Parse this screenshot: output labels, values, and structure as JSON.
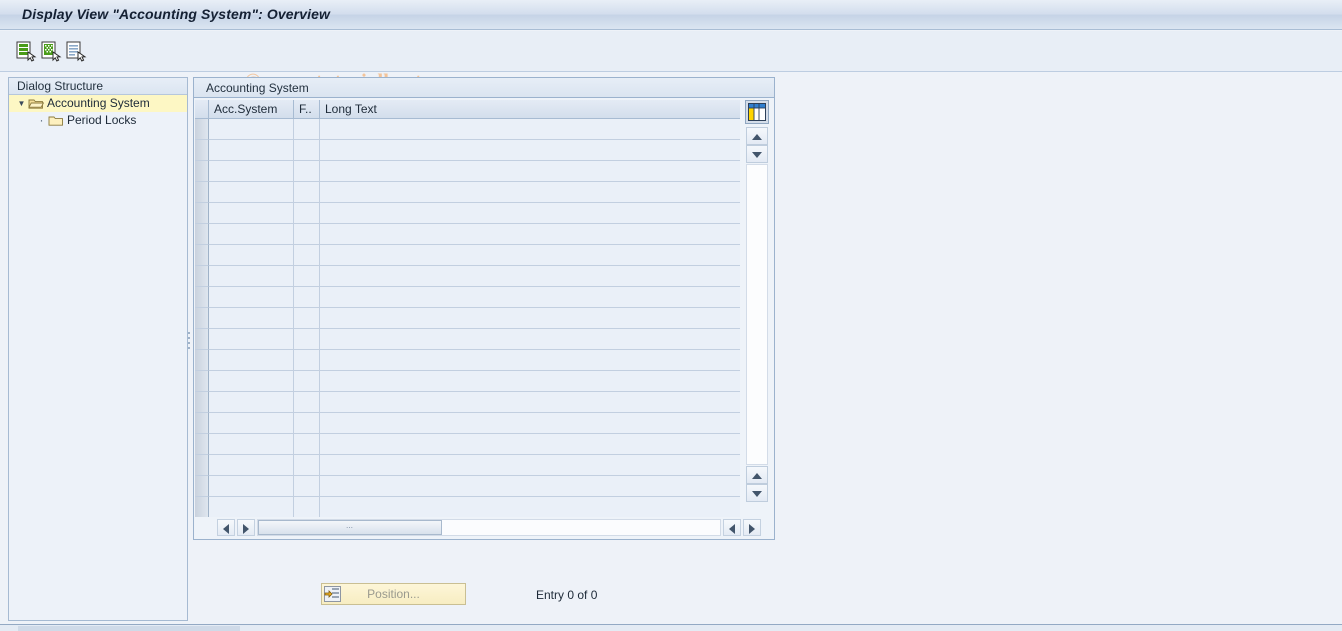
{
  "window": {
    "title": "Display View \"Accounting System\": Overview"
  },
  "watermark": {
    "text": "© www.tutorialkart.com",
    "color": "#f3c49a"
  },
  "toolbar": {
    "buttons": [
      {
        "name": "new-entries-icon",
        "tooltip": "New Entries"
      },
      {
        "name": "copy-as-icon",
        "tooltip": "Copy As..."
      },
      {
        "name": "details-icon",
        "tooltip": "Details"
      }
    ]
  },
  "sidebar": {
    "header": "Dialog Structure",
    "items": [
      {
        "label": "Accounting System",
        "level": 0,
        "selected": true,
        "expanded": true,
        "icon": "open-folder-icon"
      },
      {
        "label": "Period Locks",
        "level": 1,
        "selected": false,
        "expanded": false,
        "icon": "folder-icon"
      }
    ]
  },
  "table": {
    "title": "Accounting System",
    "columns": [
      {
        "key": "sel",
        "label": ""
      },
      {
        "key": "c1",
        "label": "Acc.System"
      },
      {
        "key": "c2",
        "label": "F.."
      },
      {
        "key": "c3",
        "label": "Long Text"
      }
    ],
    "rows": [],
    "empty_row_count": 19,
    "config_button": {
      "name": "table-settings-icon",
      "tooltip": "Table Settings"
    }
  },
  "footer": {
    "position_button": {
      "label": "Position...",
      "enabled": false
    },
    "entry_count": "Entry 0 of 0"
  },
  "colors": {
    "accent": "#a6bad2",
    "selection": "#fdf7c4",
    "panel": "#eef3f9",
    "header_gradient_top": "#e9eff7",
    "header_gradient_bottom": "#c5d3e6",
    "button_yellow": "#f7edc2"
  }
}
